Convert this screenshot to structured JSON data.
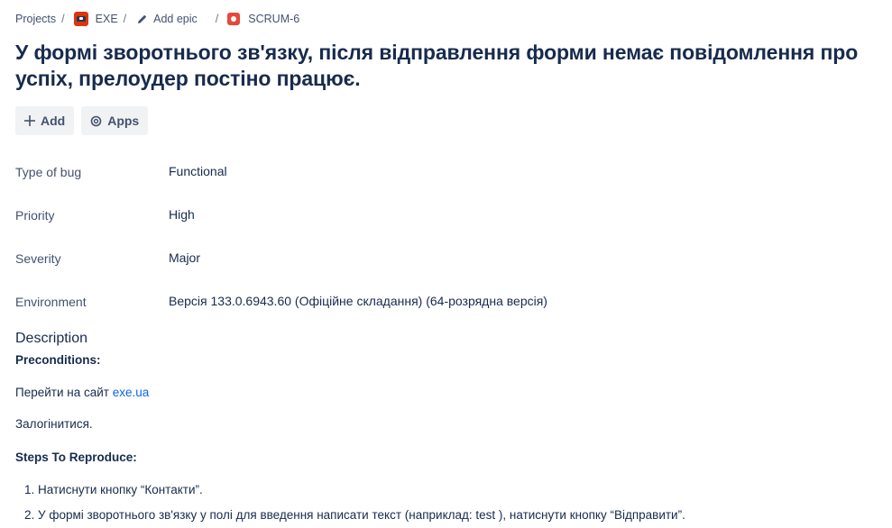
{
  "breadcrumb": {
    "projects": "Projects",
    "project": "EXE",
    "epic": "Add epic",
    "issue": "SCRUM-6",
    "separator": "/"
  },
  "title": "У формі зворотнього зв'язку, після відправлення форми немає повідомлення про успіх, прелоудер постіно працює.",
  "actions": {
    "add_label": "Add",
    "apps_label": "Apps"
  },
  "fields": [
    {
      "label": "Type of bug",
      "value": "Functional"
    },
    {
      "label": "Priority",
      "value": "High"
    },
    {
      "label": "Severity",
      "value": "Major"
    },
    {
      "label": "Environment",
      "value": "Версія 133.0.6943.60 (Офіційне складання) (64-розрядна версія)"
    }
  ],
  "description": {
    "heading": "Description",
    "preconditions_title": "Preconditions:",
    "precondition_1_text": "Перейти на сайт ",
    "precondition_1_link": "exe.ua",
    "precondition_2": "Залогінитися.",
    "steps_title": "Steps To Reproduce:",
    "steps": [
      "1. Натиснути кнопку “Контакти”.",
      "2. У формі зворотнього зв'язку у полі для введення написати текст (наприклад: test ),  натиснути кнопку “Відправити”."
    ]
  },
  "colors": {
    "text": "#172b4d",
    "label": "#42526e",
    "link": "#0c66e4",
    "button_bg": "#f1f2f4",
    "bug_icon": "#e5493a"
  }
}
